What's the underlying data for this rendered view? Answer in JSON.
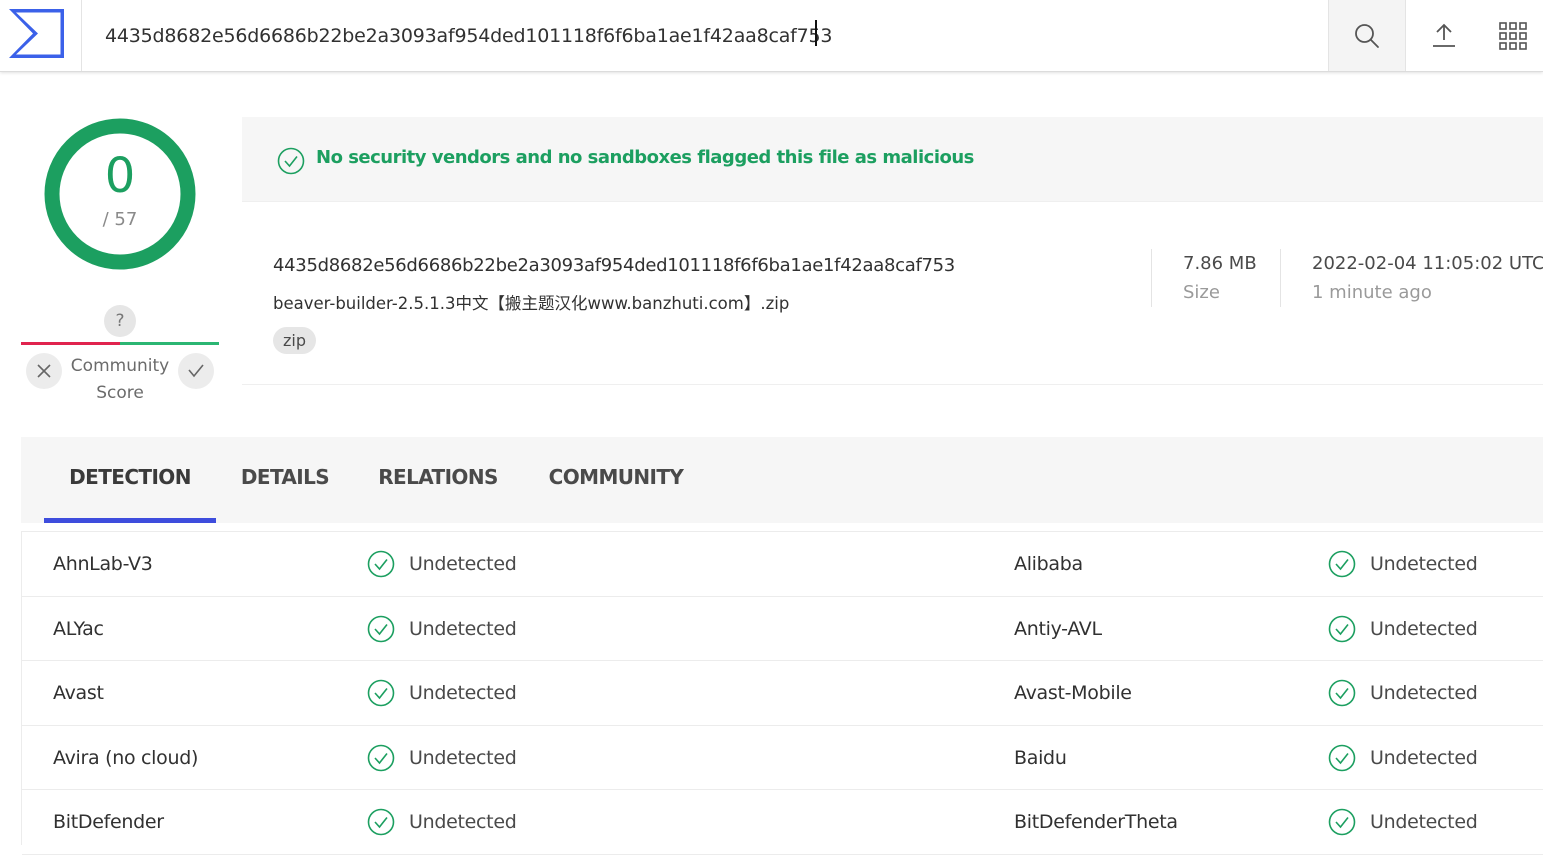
{
  "search": {
    "value": "4435d8682e56d6686b22be2a3093af954ded101118f6f6ba1ae1f42aa8caf753"
  },
  "colors": {
    "accent": "#3e4ddd",
    "clean": "#1c9f60",
    "malicious": "#e0234e"
  },
  "icons": {
    "logo": "virustotal-logo",
    "search": "search-icon",
    "upload": "upload-icon",
    "apps": "grid-icon"
  },
  "score": {
    "detections": "0",
    "total": "/ 57"
  },
  "community": {
    "question": "?",
    "label_line1": "Community",
    "label_line2": "Score"
  },
  "banner": {
    "text": "No security vendors and no sandboxes flagged this file as malicious"
  },
  "file": {
    "hash": "4435d8682e56d6686b22be2a3093af954ded101118f6f6ba1ae1f42aa8caf753",
    "name": "beaver-builder-2.5.1.3中文【搬主题汉化www.banzhuti.com】.zip",
    "tag": "zip",
    "size": "7.86 MB",
    "size_label": "Size",
    "date": "2022-02-04 11:05:02 UTC",
    "date_relative": "1 minute ago"
  },
  "tabs": [
    "DETECTION",
    "DETAILS",
    "RELATIONS",
    "COMMUNITY"
  ],
  "detections": [
    {
      "left": {
        "vendor": "AhnLab-V3",
        "result": "Undetected"
      },
      "right": {
        "vendor": "Alibaba",
        "result": "Undetected"
      }
    },
    {
      "left": {
        "vendor": "ALYac",
        "result": "Undetected"
      },
      "right": {
        "vendor": "Antiy-AVL",
        "result": "Undetected"
      }
    },
    {
      "left": {
        "vendor": "Avast",
        "result": "Undetected"
      },
      "right": {
        "vendor": "Avast-Mobile",
        "result": "Undetected"
      }
    },
    {
      "left": {
        "vendor": "Avira (no cloud)",
        "result": "Undetected"
      },
      "right": {
        "vendor": "Baidu",
        "result": "Undetected"
      }
    },
    {
      "left": {
        "vendor": "BitDefender",
        "result": "Undetected"
      },
      "right": {
        "vendor": "BitDefenderTheta",
        "result": "Undetected"
      }
    }
  ]
}
